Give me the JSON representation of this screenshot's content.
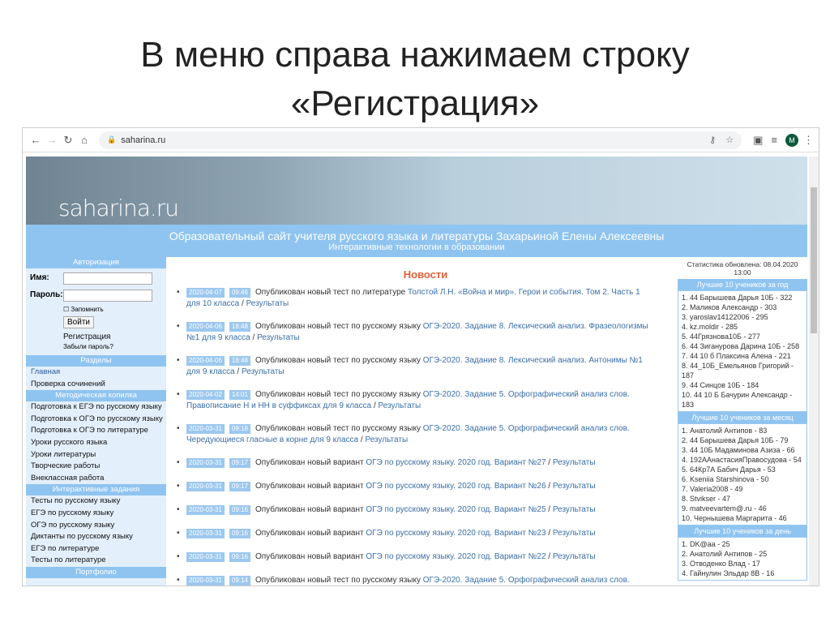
{
  "slide": {
    "title_line1": "В меню справа нажимаем строку",
    "title_line2": "«Регистрация»"
  },
  "browser": {
    "url": "saharina.ru"
  },
  "site": {
    "logo": "saharina.ru",
    "title": "Образовательный сайт учителя русского языка и литературы Захарьиной Елены Алексеевны",
    "subtitle": "Интерактивные технологии в образовании"
  },
  "left": {
    "auth_title": "Авторизация",
    "name_label": "Имя:",
    "password_label": "Пароль:",
    "remember": "Запомнить",
    "login": "Войти",
    "register": "Регистрация",
    "forgot": "Забыли пароль?",
    "sections_title": "Разделы",
    "sections": [
      "Главная",
      "Проверка сочинений"
    ],
    "methods_title": "Методическая копилка",
    "methods": [
      "Подготовка к ЕГЭ по русскому языку",
      "Подготовка к ОГЭ по русскому языку",
      "Подготовка к ОГЭ по литературе",
      "Уроки русского языка",
      "Уроки литературы",
      "Творческие работы",
      "Внеклассная работа"
    ],
    "interactive_title": "Интерактивные задания",
    "interactive": [
      "Тесты по русскому языку",
      "ЕГЭ по русскому языку",
      "ОГЭ по русскому языку",
      "Диктанты по русскому языку",
      "ЕГЭ по литературе",
      "Тесты по литературе"
    ],
    "portfolio_title": "Портфолио"
  },
  "news": {
    "title": "Новости",
    "items": [
      {
        "date": "2020-04-07",
        "time": "09:46",
        "prefix": "Опубликован новый тест по литературе",
        "link": "Толстой Л.Н. «Война и мир». Герои и события. Том 2. Часть 1 для 10 класса",
        "results": "Результаты"
      },
      {
        "date": "2020-04-06",
        "time": "18:48",
        "prefix": "Опубликован новый тест по русскому языку",
        "link": "ОГЭ-2020. Задание 8. Лексический анализ. Фразеологизмы №1 для 9 класса",
        "results": "Результаты"
      },
      {
        "date": "2020-04-06",
        "time": "18:48",
        "prefix": "Опубликован новый тест по русскому языку",
        "link": "ОГЭ-2020. Задание 8. Лексический анализ. Антонимы №1 для 9 класса",
        "results": "Результаты"
      },
      {
        "date": "2020-04-02",
        "time": "14:01",
        "prefix": "Опубликован новый тест по русскому языку",
        "link": "ОГЭ-2020. Задание 5. Орфографический анализ слов. Правописание Н и НН в суффиксах для 9 класса",
        "results": "Результаты"
      },
      {
        "date": "2020-03-31",
        "time": "09:18",
        "prefix": "Опубликован новый тест по русскому языку",
        "link": "ОГЭ-2020. Задание 5. Орфографический анализ слов. Чередующиеся гласные в корне для 9 класса",
        "results": "Результаты"
      },
      {
        "date": "2020-03-31",
        "time": "09:17",
        "prefix": "Опубликован новый вариант",
        "link": "ОГЭ по русскому языку. 2020 год. Вариант №27",
        "results": "Результаты"
      },
      {
        "date": "2020-03-31",
        "time": "09:17",
        "prefix": "Опубликован новый вариант",
        "link": "ОГЭ по русскому языку. 2020 год. Вариант №26",
        "results": "Результаты"
      },
      {
        "date": "2020-03-31",
        "time": "09:16",
        "prefix": "Опубликован новый вариант",
        "link": "ОГЭ по русскому языку. 2020 год. Вариант №25",
        "results": "Результаты"
      },
      {
        "date": "2020-03-31",
        "time": "09:16",
        "prefix": "Опубликован новый вариант",
        "link": "ОГЭ по русскому языку. 2020 год. Вариант №23",
        "results": "Результаты"
      },
      {
        "date": "2020-03-31",
        "time": "09:16",
        "prefix": "Опубликован новый вариант",
        "link": "ОГЭ по русскому языку. 2020 год. Вариант №22",
        "results": "Результаты"
      },
      {
        "date": "2020-03-31",
        "time": "09:14",
        "prefix": "Опубликован новый тест по русскому языку",
        "link": "ОГЭ-2020. Задание 5. Орфографический анализ слов.",
        "results": ""
      }
    ]
  },
  "right": {
    "stat": "Статистика обновлена: 08.04.2020 13:00",
    "year_title": "Лучшие 10 учеников за год",
    "year": [
      "1. 44 Барышева Дарья 10Б - 322",
      "2. Маликов Александр - 303",
      "3. yaroslav14122006 - 295",
      "4. kz.moldir - 285",
      "5. 44Грязнова10Б - 277",
      "6. 44 Зиганурова Дарина 10Б - 258",
      "7. 44 10 б Плаксина Алена - 221",
      "8. 44_10Б_Емельянов Григорий - 187",
      "9. 44 Синцов 10Б - 184",
      "10. 44 10 Б Бачурин Александр - 183"
    ],
    "month_title": "Лучшие 10 учеников за месяц",
    "month": [
      "1. Анатолий Антипов - 83",
      "2. 44 Барышева Дарья 10Б - 79",
      "3. 44 10Б Мадаминова Азиза - 66",
      "4. 192ААнастасияПравосудова - 54",
      "5. 64Кр7А Бабич Дарья - 53",
      "6. Kseniia Starshinova - 50",
      "7. Valeria2008 - 49",
      "8. Stvikser - 47",
      "9. matveevartem@.ru - 46",
      "10. Чернышева Маргарита - 46"
    ],
    "day_title": "Лучшие 10 учеников за день",
    "day": [
      "1. DK@aa - 25",
      "2. Анатолий Антипов - 25",
      "3. Отводенко Влад - 17",
      "4. Гайнулин Эльдар 8В - 16"
    ]
  }
}
